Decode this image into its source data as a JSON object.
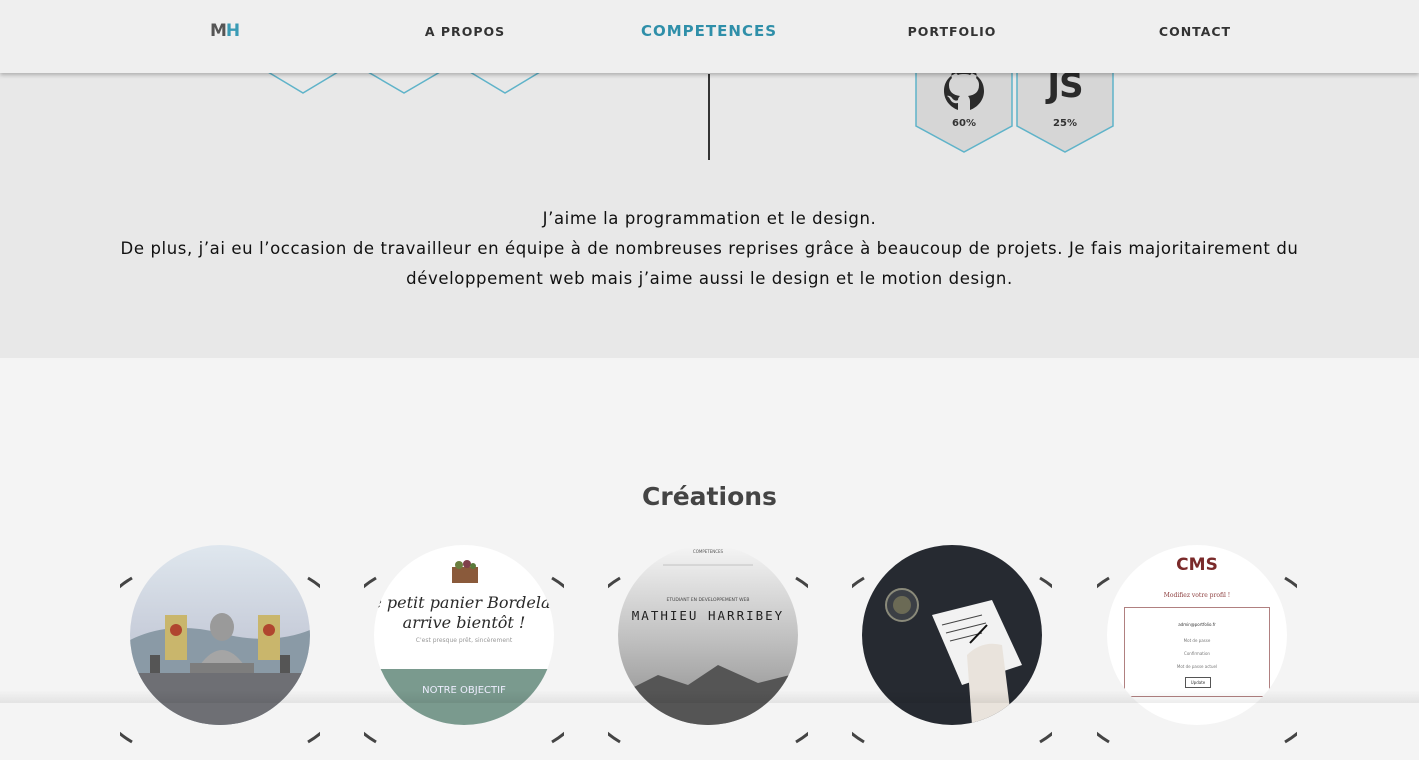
{
  "header": {
    "logo_m": "M",
    "logo_h": "H",
    "nav": [
      "A PROPOS",
      "COMPETENCES",
      "PORTFOLIO",
      "CONTACT"
    ],
    "active_nav": "COMPETENCES"
  },
  "skills": {
    "badges": [
      {
        "icon": "github-icon",
        "percent": "60%"
      },
      {
        "icon": "js-icon",
        "label": "JS",
        "percent": "25%"
      }
    ],
    "about": [
      "J’aime la programmation et le design.",
      "De plus, j’ai eu l’occasion de travailleur en équipe à de nombreuses reprises grâce à beaucoup de projets. Je fais majoritairement du développement web mais j’aime aussi le design et le motion design."
    ]
  },
  "creations": {
    "title": "Créations",
    "projects": [
      {
        "name": "buddha-temple"
      },
      {
        "name": "petit-panier",
        "line1": "e petit panier Bordelai",
        "line2": "arrive bientôt !",
        "sub": "C'est presque prêt, sincèrement",
        "banner": "NOTRE OBJECTIF"
      },
      {
        "name": "portfolio-site",
        "top": "COMPETENCES",
        "tag": "ETUDIANT EN DEVELOPPEMENT WEB",
        "title": "MATHIEU HARRIBEY"
      },
      {
        "name": "notebook-desk"
      },
      {
        "name": "cms",
        "title": "CMS",
        "subtitle": "Modifiez votre profil !",
        "email": "admin@portfolio.fr",
        "f1": "Mot de passe",
        "f2": "Confirmation",
        "f3": "Mot de passe actuel",
        "button": "Update"
      }
    ]
  },
  "colors": {
    "accent": "#2f8fa9",
    "hex_border": "#5fb3c9",
    "grey_bg": "#e8e8e8"
  }
}
